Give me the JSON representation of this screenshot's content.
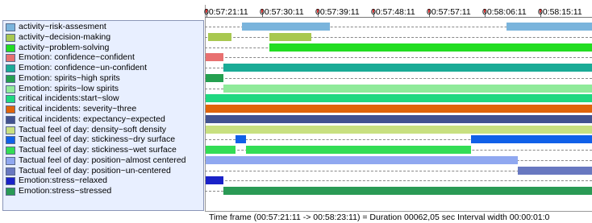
{
  "timeline": {
    "ticks": [
      "00:57:21:11",
      "00:57:30:11",
      "00:57:39:11",
      "00:57:48:11",
      "00:57:57:11",
      "00:58:06:11",
      "00:58:15:11"
    ],
    "start": "00:57:21:11",
    "end": "00:58:23:11"
  },
  "status": {
    "text": "Time frame  (00:57:21:11 -> 00:58:23:11) = Duration 00062,05 sec   Interval width 00:00:01:0"
  },
  "tracks": [
    {
      "label": "activity~risk-assesment",
      "color": "#7ab4dc",
      "segments": [
        [
          40.6,
          54.8
        ],
        [
          83.2,
          97.0
        ]
      ]
    },
    {
      "label": "activity~decision-making",
      "color": "#a8c850",
      "segments": [
        [
          35.1,
          38.9
        ],
        [
          45.0,
          51.8
        ]
      ]
    },
    {
      "label": "activity~problem-solving",
      "color": "#22dd22",
      "segments": [
        [
          45.0,
          97.0
        ]
      ]
    },
    {
      "label": "Emotion: confidence~confident",
      "color": "#e87070",
      "segments": [
        [
          34.6,
          37.6
        ]
      ]
    },
    {
      "label": "Emotion: confidence~un-confident",
      "color": "#1aab96",
      "segments": [
        [
          37.6,
          97.0
        ]
      ]
    },
    {
      "label": "Emotion: spirits~high sprits",
      "color": "#25a050",
      "segments": [
        [
          34.6,
          37.6
        ]
      ]
    },
    {
      "label": "Emotion: spirits~low spirits",
      "color": "#8fea9a",
      "segments": [
        [
          37.6,
          97.0
        ]
      ]
    },
    {
      "label": "critical incidents:start~slow",
      "color": "#1fd880",
      "segments": [
        [
          34.6,
          97.0
        ]
      ]
    },
    {
      "label": "critical incidents: severity~three",
      "color": "#e0640a",
      "segments": [
        [
          34.6,
          97.0
        ]
      ]
    },
    {
      "label": "critical incidents: expectancy~expected",
      "color": "#425290",
      "segments": [
        [
          34.6,
          97.0
        ]
      ]
    },
    {
      "label": "Tactual feel of day: density~soft density",
      "color": "#c8e080",
      "segments": [
        [
          34.6,
          97.0
        ]
      ]
    },
    {
      "label": "Tactual feel of day: stickiness~dry surface",
      "color": "#1060e8",
      "segments": [
        [
          39.6,
          41.2
        ],
        [
          77.5,
          97.0
        ]
      ]
    },
    {
      "label": "Tactual feel of day: stickiness~wet surface",
      "color": "#33dd55",
      "segments": [
        [
          34.6,
          39.6
        ],
        [
          41.2,
          77.5
        ]
      ]
    },
    {
      "label": "Tactual feel of day: position~almost centered",
      "color": "#90a8f0",
      "segments": [
        [
          34.6,
          85.0
        ]
      ]
    },
    {
      "label": "Tactual feel of day: position~un-centered",
      "color": "#6878c0",
      "segments": [
        [
          85.0,
          97.0
        ]
      ]
    },
    {
      "label": "Emotion:stress~relaxed",
      "color": "#1a22c8",
      "segments": [
        [
          34.6,
          37.6
        ]
      ]
    },
    {
      "label": "Emotion:stress~stressed",
      "color": "#2a9a55",
      "segments": [
        [
          37.6,
          97.0
        ]
      ]
    }
  ]
}
